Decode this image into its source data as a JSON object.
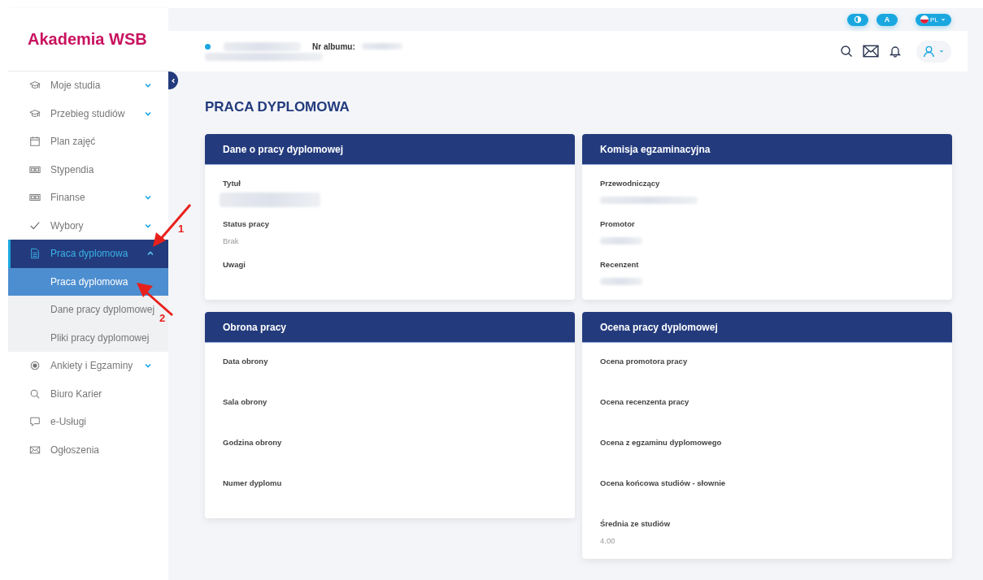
{
  "logo": "Akademia WSB",
  "top_bar": {
    "font_button": "A",
    "language": "PL"
  },
  "header": {
    "student_redacted": true,
    "album_label": "Nr albumu:",
    "album_redacted": true
  },
  "sidebar": {
    "items": [
      {
        "label": "Moje studia",
        "kind": "group",
        "expanded": false,
        "selected": false
      },
      {
        "label": "Przebieg studiów",
        "kind": "group",
        "expanded": false,
        "selected": false
      },
      {
        "label": "Plan zajęć",
        "kind": "link",
        "selected": false
      },
      {
        "label": "Stypendia",
        "kind": "link",
        "selected": false
      },
      {
        "label": "Finanse",
        "kind": "group",
        "expanded": false,
        "selected": false
      },
      {
        "label": "Wybory",
        "kind": "group",
        "expanded": false,
        "selected": false
      },
      {
        "label": "Praca dyplomowa",
        "kind": "group",
        "expanded": true,
        "selected": true,
        "children": [
          {
            "label": "Praca dyplomowa",
            "selected": true
          },
          {
            "label": "Dane pracy dyplomowej",
            "selected": false
          },
          {
            "label": "Pliki pracy dyplomowej",
            "selected": false
          }
        ]
      },
      {
        "label": "Ankiety i Egzaminy",
        "kind": "group",
        "expanded": false,
        "selected": false
      },
      {
        "label": "Biuro Karier",
        "kind": "link",
        "selected": false
      },
      {
        "label": "e-Usługi",
        "kind": "link",
        "selected": false
      },
      {
        "label": "Ogłoszenia",
        "kind": "link",
        "selected": false
      }
    ]
  },
  "page_title": "PRACA DYPLOMOWA",
  "cards": [
    {
      "title": "Dane o pracy dyplomowej",
      "fields": [
        {
          "label": "Tytuł",
          "redacted": true
        },
        {
          "label": "Status pracy",
          "value": "Brak"
        },
        {
          "label": "Uwagi"
        }
      ]
    },
    {
      "title": "Komisja egzaminacyjna",
      "fields": [
        {
          "label": "Przewodniczący",
          "redacted": true
        },
        {
          "label": "Promotor",
          "redacted": true
        },
        {
          "label": "Recenzent",
          "redacted": true
        }
      ]
    },
    {
      "title": "Obrona pracy",
      "fields": [
        {
          "label": "Data obrony"
        },
        {
          "label": "Sala obrony"
        },
        {
          "label": "Godzina obrony"
        },
        {
          "label": "Numer dyplomu"
        }
      ]
    },
    {
      "title": "Ocena pracy dyplomowej",
      "fields": [
        {
          "label": "Ocena promotora pracy"
        },
        {
          "label": "Ocena recenzenta pracy"
        },
        {
          "label": "Ocena z egzaminu dyplomowego"
        },
        {
          "label": "Ocena końcowa studiów - słownie"
        },
        {
          "label": "Średnia ze studiów",
          "value": "4.00"
        }
      ]
    }
  ],
  "annotations": [
    {
      "label": "1"
    },
    {
      "label": "2"
    }
  ]
}
